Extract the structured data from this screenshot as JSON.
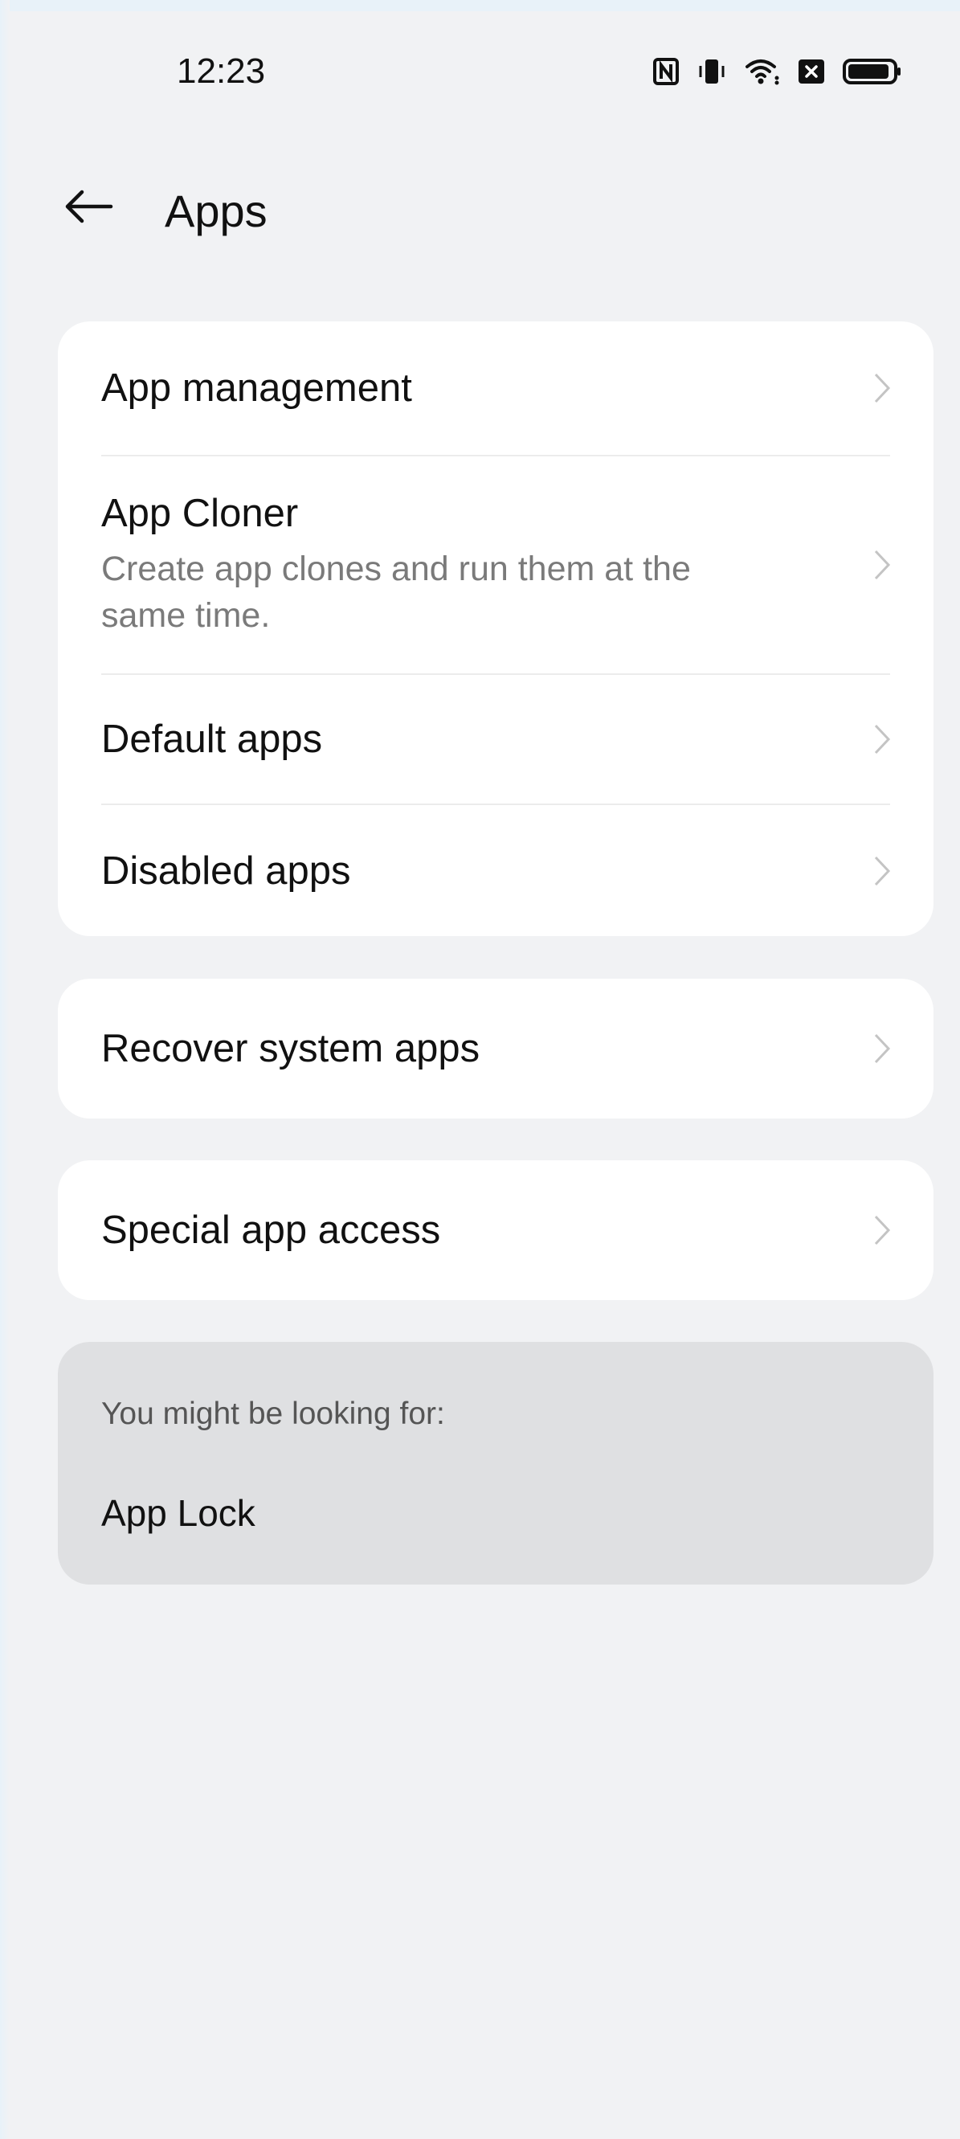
{
  "status_bar": {
    "time": "12:23",
    "icons": [
      "nfc-icon",
      "vibrate-icon",
      "wifi-icon",
      "no-sim-icon",
      "battery-icon"
    ]
  },
  "header": {
    "back_icon": "back-arrow-icon",
    "title": "Apps"
  },
  "group1": {
    "items": [
      {
        "title": "App management",
        "subtitle": ""
      },
      {
        "title": "App Cloner",
        "subtitle": "Create app clones and run them at the same time."
      },
      {
        "title": "Default apps",
        "subtitle": ""
      },
      {
        "title": "Disabled apps",
        "subtitle": ""
      }
    ]
  },
  "group2": {
    "items": [
      {
        "title": "Recover system apps"
      }
    ]
  },
  "group3": {
    "items": [
      {
        "title": "Special app access"
      }
    ]
  },
  "suggestions": {
    "heading": "You might be looking for:",
    "items": [
      "App Lock"
    ]
  },
  "colors": {
    "background": "#f1f2f4",
    "card": "#ffffff",
    "suggestion_card": "#dfe0e2",
    "chevron": "#c4c4c4"
  }
}
